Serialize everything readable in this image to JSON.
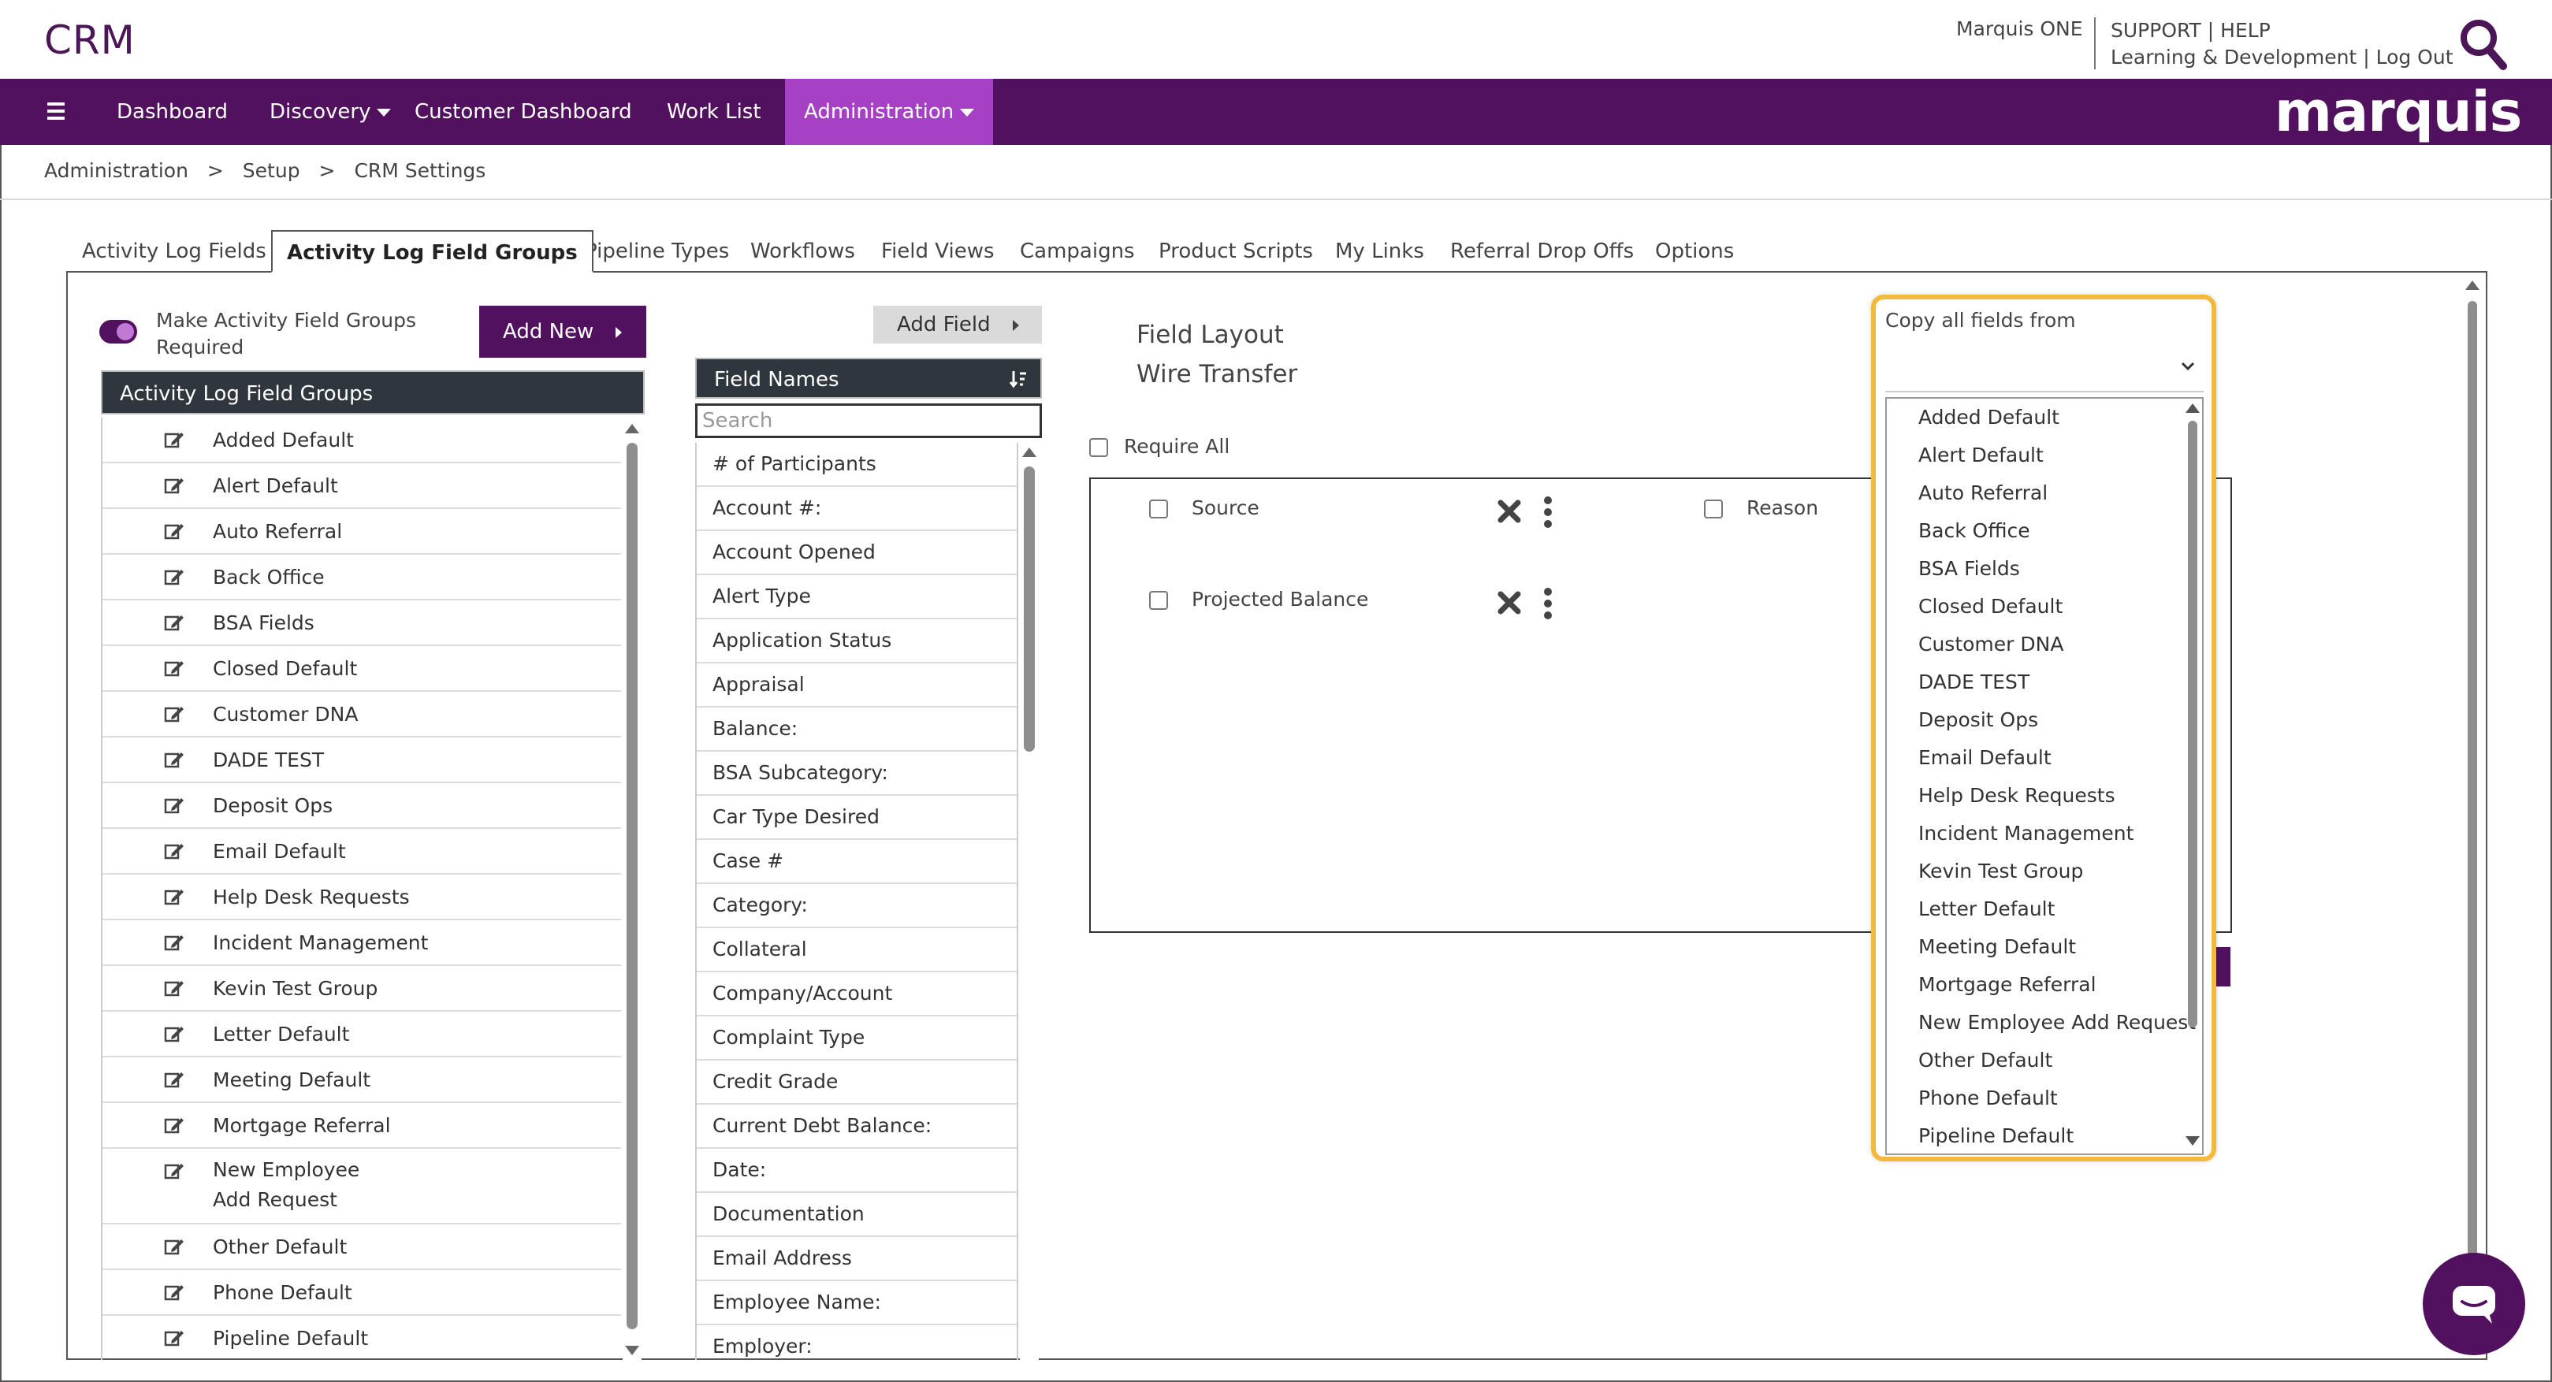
{
  "app": {
    "title": "CRM"
  },
  "header": {
    "marquis_one": "Marquis ONE",
    "support": "SUPPORT",
    "help": "HELP",
    "learning": "Learning & Development",
    "logout": "Log Out",
    "pipe": "|"
  },
  "nav": {
    "items": [
      "Dashboard",
      "Discovery",
      "Customer Dashboard",
      "Work List",
      "Administration"
    ],
    "brand": "marquis",
    "accent_color": "#51115e",
    "active_color": "#a641c5"
  },
  "breadcrumb": {
    "items": [
      "Administration",
      "Setup",
      "CRM Settings"
    ],
    "separator": ">"
  },
  "tabs": [
    "Activity Log Fields",
    "Activity Log Field Groups",
    "Pipeline Types",
    "Workflows",
    "Field Views",
    "Campaigns",
    "Product Scripts",
    "My Links",
    "Referral Drop Offs",
    "Options"
  ],
  "active_tab": "Activity Log Field Groups",
  "left": {
    "toggle_label": "Make Activity Field Groups Required",
    "add_new": "Add New",
    "groups_header": "Activity Log Field Groups",
    "groups": [
      "Added Default",
      "Alert Default",
      "Auto Referral",
      "Back Office",
      "BSA Fields",
      "Closed Default",
      "Customer DNA",
      "DADE TEST",
      "Deposit Ops",
      "Email Default",
      "Help Desk Requests",
      "Incident Management",
      "Kevin Test Group",
      "Letter Default",
      "Meeting Default",
      "Mortgage Referral",
      "New Employee Add Request",
      "Other Default",
      "Phone Default",
      "Pipeline Default"
    ]
  },
  "fields": {
    "add_field": "Add Field",
    "header": "Field Names",
    "search_placeholder": "Search",
    "items": [
      "# of Participants",
      "Account #:",
      "Account Opened",
      "Alert Type",
      "Application Status",
      "Appraisal",
      "Balance:",
      "BSA Subcategory:",
      "Car Type Desired",
      "Case #",
      "Category:",
      "Collateral",
      "Company/Account",
      "Complaint Type",
      "Credit Grade",
      "Current Debt Balance:",
      "Date:",
      "Documentation",
      "Email Address",
      "Employee Name:",
      "Employer:"
    ]
  },
  "layout": {
    "title": "Field Layout",
    "group_name": "Wire Transfer",
    "require_all": "Require All",
    "fields": [
      "Source",
      "Projected Balance",
      "Reason"
    ]
  },
  "copy_dropdown": {
    "label": "Copy all fields from",
    "selected": "",
    "options": [
      "Added Default",
      "Alert Default",
      "Auto Referral",
      "Back Office",
      "BSA Fields",
      "Closed Default",
      "Customer DNA",
      "DADE TEST",
      "Deposit Ops",
      "Email Default",
      "Help Desk Requests",
      "Incident Management",
      "Kevin Test Group",
      "Letter Default",
      "Meeting Default",
      "Mortgage Referral",
      "New Employee Add Request",
      "Other Default",
      "Phone Default",
      "Pipeline Default"
    ],
    "highlight_color": "#f4b93c"
  }
}
